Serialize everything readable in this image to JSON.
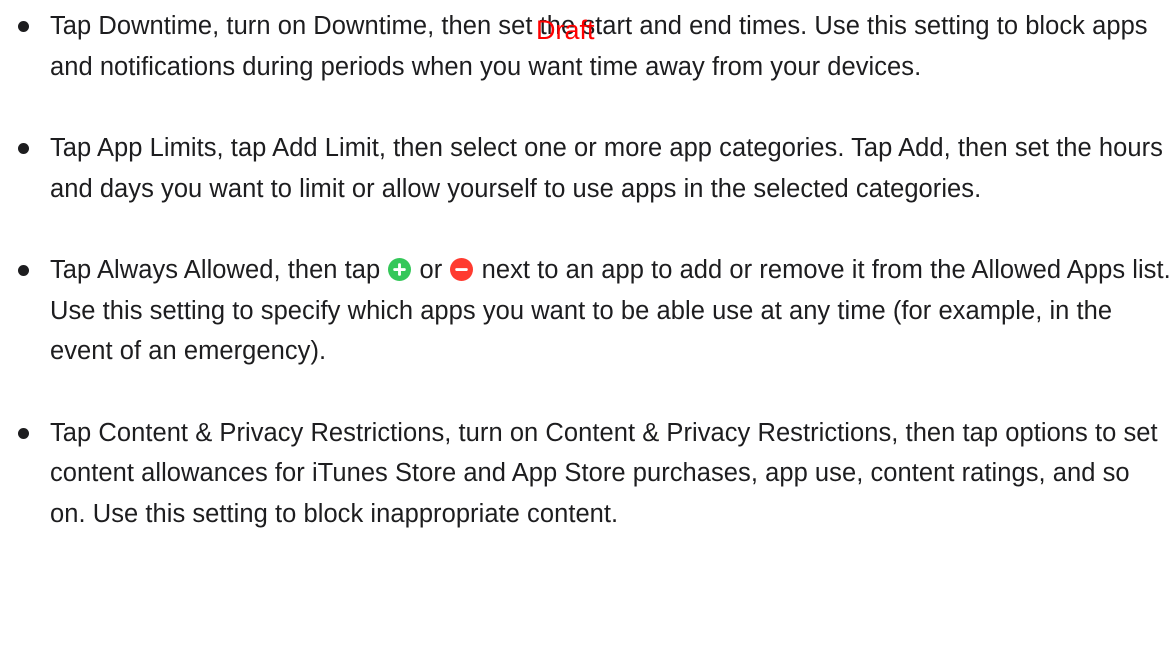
{
  "watermark": "Draft",
  "items": [
    {
      "text": "Tap Downtime, turn on Downtime, then set the start and end times. Use this setting to block apps and notifications during periods when you want time away from your devices."
    },
    {
      "text": "Tap App Limits, tap Add Limit, then select one or more app categories. Tap Add, then set the hours and days you want to limit or allow yourself to use apps in the selected categories."
    },
    {
      "text_before": "Tap Always Allowed, then tap ",
      "icon_add": "plus-circle-green-icon",
      "text_middle": " or ",
      "icon_remove": "minus-circle-red-icon",
      "text_after": " next to an app to add or remove it from the Allowed Apps list. Use this setting to specify which apps you want to be able use at any time (for example, in the event of an emergency)."
    },
    {
      "text": "Tap Content & Privacy Restrictions, turn on Content & Privacy Restrictions, then tap options to set content allowances for iTunes Store and App Store purchases, app use, content ratings, and so on. Use this setting to block inappropriate content."
    }
  ],
  "colors": {
    "text": "#1d1d1f",
    "add_icon": "#34c759",
    "remove_icon": "#ff3b30",
    "watermark": "#ff0000"
  }
}
